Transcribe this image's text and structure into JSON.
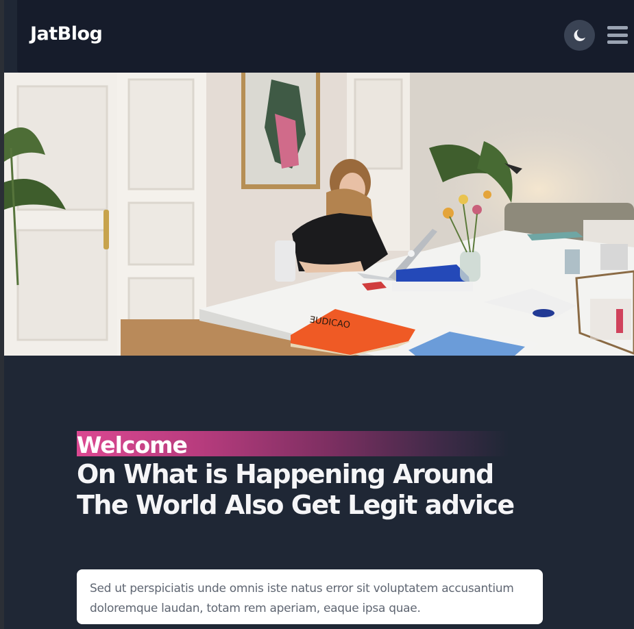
{
  "nav": {
    "brand": "JatBlog",
    "theme_toggle_icon": "moon-icon",
    "menu_icon": "hamburger-menu-icon"
  },
  "hero": {
    "image": "office-woman-laptop-photo"
  },
  "intro": {
    "welcome": "Welcome",
    "headline": "On What is Happening Around The World Also Get Legit advice",
    "description": "Sed ut perspiciatis unde omnis iste natus error sit voluptatem accusantium doloremque laudan, totam rem aperiam, eaque ipsa quae."
  },
  "colors": {
    "nav_bg": "#161c2b",
    "page_bg": "#1f2735",
    "accent": "#db4891"
  }
}
